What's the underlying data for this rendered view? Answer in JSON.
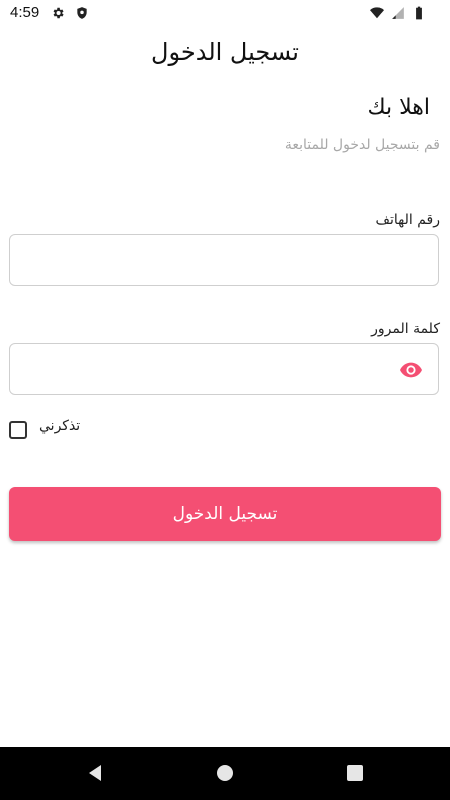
{
  "status_bar": {
    "time": "4:59",
    "icons": [
      "gear-icon",
      "shield-icon",
      "wifi-icon",
      "signal-icon",
      "battery-icon"
    ]
  },
  "header": {
    "title": "تسجيل الدخول"
  },
  "welcome": {
    "title": "اهلا بك",
    "subtitle": "قم بتسجيل لدخول للمتابعة"
  },
  "form": {
    "phone": {
      "label": "رقم الهاتف",
      "value": ""
    },
    "password": {
      "label": "كلمة المرور",
      "value": "",
      "icon": "eye-icon"
    },
    "remember": {
      "label": "تذكرني",
      "checked": false
    },
    "submit_label": "تسجيل الدخول"
  },
  "colors": {
    "accent": "#f44f73",
    "placeholder": "#a8a8a8",
    "border": "#cfcfcf"
  },
  "nav_bar": {
    "icons": [
      "back-icon",
      "home-icon",
      "recents-icon"
    ]
  }
}
